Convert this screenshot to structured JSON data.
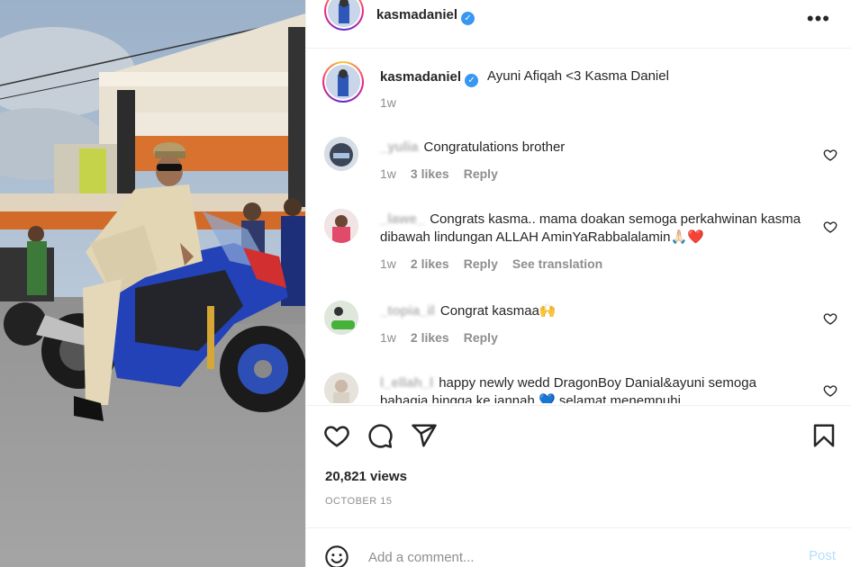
{
  "header": {
    "username": "kasmadaniel",
    "verified_icon": "✓",
    "more_icon": "•••"
  },
  "caption": {
    "username": "kasmadaniel",
    "text": "Ayuni Afiqah <3 Kasma Daniel",
    "time": "1w"
  },
  "comments": [
    {
      "username": "_yulia",
      "text": "Congratulations brother",
      "time": "1w",
      "likes": "3 likes",
      "reply": "Reply",
      "translation": ""
    },
    {
      "username": "_lawe_",
      "text": "Congrats kasma.. mama doakan semoga perkahwinan kasma dibawah lindungan ALLAH AminYaRabbalalamin🙏🏻❤️",
      "time": "1w",
      "likes": "2 likes",
      "reply": "Reply",
      "translation": "See translation"
    },
    {
      "username": "_topia_il",
      "text": "Congrat kasmaa🙌",
      "time": "1w",
      "likes": "2 likes",
      "reply": "Reply",
      "translation": ""
    },
    {
      "username": "l_ellah_l",
      "text": "happy newly wedd DragonBoy Danial&ayuni semoga bahagia hingga ke jannah 💙 selamat menempuhi",
      "time": "",
      "likes": "",
      "reply": "",
      "translation": ""
    }
  ],
  "actions": {
    "like_icon": "heart-icon",
    "comment_icon": "comment-icon",
    "share_icon": "share-icon",
    "save_icon": "bookmark-icon",
    "views": "20,821 views",
    "date": "OCTOBER 15"
  },
  "add_comment": {
    "placeholder": "Add a comment...",
    "post_label": "Post"
  },
  "colors": {
    "verified": "#3897f0",
    "muted": "#8e8e8e",
    "post_disabled": "#b2dffc",
    "heart_red": "#ed4956"
  }
}
